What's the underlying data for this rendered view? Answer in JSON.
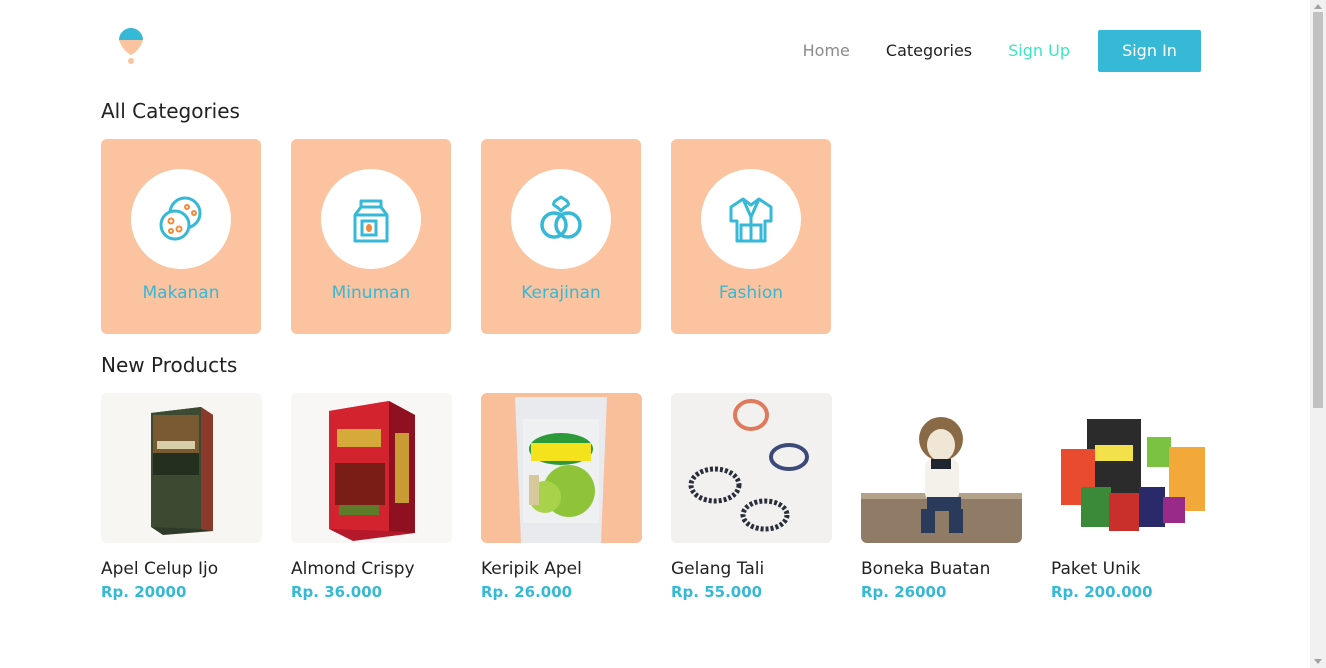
{
  "header": {
    "logo_icon": "balloon-icon",
    "nav": {
      "home": "Home",
      "categories": "Categories",
      "sign_up": "Sign Up",
      "sign_in": "Sign In"
    }
  },
  "sections": {
    "categories_title": "All Categories",
    "products_title": "New Products"
  },
  "categories": [
    {
      "label": "Makanan",
      "icon": "cookie-icon"
    },
    {
      "label": "Minuman",
      "icon": "milk-carton-icon"
    },
    {
      "label": "Kerajinan",
      "icon": "rings-icon"
    },
    {
      "label": "Fashion",
      "icon": "jacket-icon"
    }
  ],
  "products": [
    {
      "name": "Apel Celup Ijo",
      "price": "Rp. 20000"
    },
    {
      "name": "Almond Crispy",
      "price": "Rp. 36.000"
    },
    {
      "name": "Keripik Apel",
      "price": "Rp. 26.000"
    },
    {
      "name": "Gelang Tali",
      "price": "Rp. 55.000"
    },
    {
      "name": "Boneka Buatan",
      "price": "Rp. 26000"
    },
    {
      "name": "Paket Unik",
      "price": "Rp. 200.000"
    }
  ],
  "colors": {
    "accent": "#36b8d7",
    "category_card": "#fbc39f",
    "sign_up": "#39e6c4"
  }
}
